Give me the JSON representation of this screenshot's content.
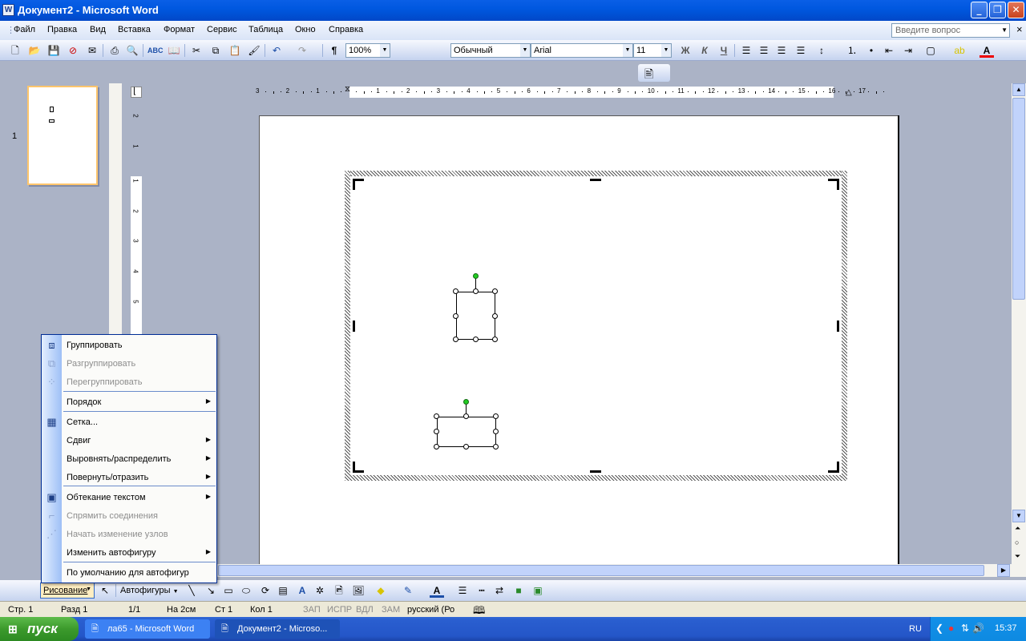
{
  "window": {
    "title": "Документ2 - Microsoft Word",
    "app_icon": "W"
  },
  "menu": {
    "items": [
      "Файл",
      "Правка",
      "Вид",
      "Вставка",
      "Формат",
      "Сервис",
      "Таблица",
      "Окно",
      "Справка"
    ],
    "ask_placeholder": "Введите вопрос"
  },
  "toolbar": {
    "zoom": "100%",
    "style": "Обычный",
    "font": "Arial",
    "size": "11",
    "bold": "Ж",
    "italic": "К",
    "underline": "Ч",
    "pilcrow": "¶"
  },
  "ruler": {
    "h_ticks": [
      "3",
      "2",
      "1",
      "",
      "1",
      "2",
      "3",
      "4",
      "5",
      "6",
      "7",
      "8",
      "9",
      "10",
      "11",
      "12",
      "13",
      "14",
      "15",
      "16",
      "17"
    ],
    "v_ticks": [
      "2",
      "1",
      "1",
      "2",
      "3",
      "4",
      "5"
    ]
  },
  "thumbnails": {
    "page_number": "1"
  },
  "context_menu": {
    "items": [
      {
        "label": "Группировать",
        "enabled": true,
        "icon": "group-icon"
      },
      {
        "label": "Разгруппировать",
        "enabled": false,
        "icon": "ungroup-icon"
      },
      {
        "label": "Перегруппировать",
        "enabled": false,
        "icon": "regroup-icon"
      },
      {
        "label": "Порядок",
        "enabled": true,
        "submenu": true
      },
      {
        "label": "Сетка...",
        "enabled": true,
        "icon": "grid-icon"
      },
      {
        "label": "Сдвиг",
        "enabled": true,
        "submenu": true
      },
      {
        "label": "Выровнять/распределить",
        "enabled": true,
        "submenu": true
      },
      {
        "label": "Повернуть/отразить",
        "enabled": true,
        "submenu": true
      },
      {
        "label": "Обтекание текстом",
        "enabled": true,
        "submenu": true,
        "icon": "text-wrap-icon"
      },
      {
        "label": "Спрямить соединения",
        "enabled": false,
        "icon": "connector-icon"
      },
      {
        "label": "Начать изменение узлов",
        "enabled": false,
        "icon": "edit-points-icon"
      },
      {
        "label": "Изменить автофигуру",
        "enabled": true,
        "submenu": true
      },
      {
        "label": "По умолчанию для автофигур",
        "enabled": true
      }
    ]
  },
  "drawing_toolbar": {
    "draw_label": "Рисование",
    "autoshapes_label": "Автофигуры"
  },
  "status": {
    "page": "Стр. 1",
    "section": "Разд 1",
    "pages": "1/1",
    "at": "На 2см",
    "line": "Ст 1",
    "col": "Кол 1",
    "rec": "ЗАП",
    "trk": "ИСПР",
    "ext": "ВДЛ",
    "ovr": "ЗАМ",
    "lang": "русский (Ро"
  },
  "taskbar": {
    "start": "пуск",
    "tasks": [
      "ла65 - Microsoft Word",
      "Документ2 - Microso..."
    ],
    "lang": "RU",
    "time": "15:37"
  },
  "colors": {
    "xp_blue": "#0058e0",
    "start_green": "#3c9a2c",
    "menu_border": "#002d96",
    "rotate_handle": "#22cc22"
  }
}
